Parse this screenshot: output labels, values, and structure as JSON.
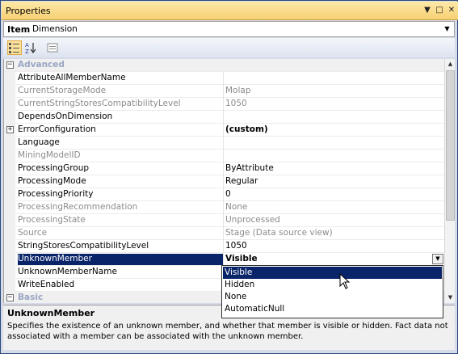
{
  "window": {
    "title": "Properties"
  },
  "item_selector": {
    "label": "Item",
    "value": "Dimension"
  },
  "toolbar": {
    "buttons": [
      "categorized-icon",
      "alphabetical-icon",
      "property-pages-icon"
    ]
  },
  "grid": {
    "categories": [
      {
        "name": "Advanced",
        "expanded": true
      },
      {
        "name": "Basic",
        "expanded": false
      }
    ],
    "properties": [
      {
        "name": "AttributeAllMemberName",
        "value": ""
      },
      {
        "name": "CurrentStorageMode",
        "value": "Molap",
        "readonly": true
      },
      {
        "name": "CurrentStringStoresCompatibilityLevel",
        "value": "1050",
        "readonly": true
      },
      {
        "name": "DependsOnDimension",
        "value": ""
      },
      {
        "name": "ErrorConfiguration",
        "value": "(custom)",
        "bold": true,
        "expandable": true
      },
      {
        "name": "Language",
        "value": ""
      },
      {
        "name": "MiningModelID",
        "value": "",
        "readonly": true
      },
      {
        "name": "ProcessingGroup",
        "value": "ByAttribute"
      },
      {
        "name": "ProcessingMode",
        "value": "Regular"
      },
      {
        "name": "ProcessingPriority",
        "value": "0"
      },
      {
        "name": "ProcessingRecommendation",
        "value": "None",
        "readonly": true
      },
      {
        "name": "ProcessingState",
        "value": "Unprocessed",
        "readonly": true
      },
      {
        "name": "Source",
        "value": "Stage (Data source view)",
        "readonly": true
      },
      {
        "name": "StringStoresCompatibilityLevel",
        "value": "1050"
      },
      {
        "name": "UnknownMember",
        "value": "Visible",
        "selected": true
      },
      {
        "name": "UnknownMemberName",
        "value": ""
      },
      {
        "name": "WriteEnabled",
        "value": ""
      }
    ]
  },
  "dropdown": {
    "options": [
      "Visible",
      "Hidden",
      "None",
      "AutomaticNull"
    ],
    "highlighted": "Visible"
  },
  "description": {
    "title": "UnknownMember",
    "text": "Specifies the existence of an unknown member, and whether that member is visible or hidden. Fact data not associated with a member can be associated with the unknown member."
  }
}
